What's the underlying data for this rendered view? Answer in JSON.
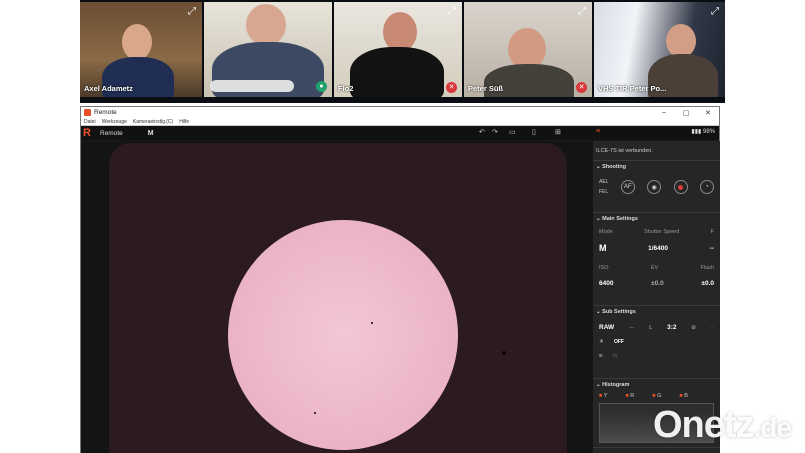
{
  "conference": {
    "participants": [
      {
        "name": "Axel Adametz",
        "muted": false
      },
      {
        "name": "",
        "muted": false
      },
      {
        "name": "Flo2",
        "muted": true
      },
      {
        "name": "Peter Süß",
        "muted": true
      },
      {
        "name": "VHS TIR Peter Po...",
        "muted": false
      }
    ]
  },
  "window": {
    "title": "Remote",
    "menu": [
      "Datei",
      "Werkzeuge",
      "Kameraeinstlg.(C)",
      "Hilfe"
    ],
    "toolbar": {
      "label": "Remote",
      "battery": "98%"
    }
  },
  "panel": {
    "status": "ILCE-7S ist verbunden.",
    "shooting": {
      "title": "Shooting",
      "af_label": "AEL",
      "fel_label": "FEL",
      "af_btn": "AF"
    },
    "main": {
      "title": "Main Settings",
      "mode_label": "Mode",
      "shutter_label": "Shutter Speed",
      "f_label": "F",
      "mode": "M",
      "shutter": "1/6400",
      "f": "--",
      "iso_label": "ISO",
      "ev_label": "EV",
      "flash_label": "Flash",
      "iso": "6400",
      "ev": "±0.0",
      "flash": "±0.0"
    },
    "sub": {
      "title": "Sub Settings",
      "raw": "RAW",
      "dash": "---",
      "l": "L",
      "ratio": "3:2",
      "off": "OFF"
    },
    "histogram": {
      "title": "Histogram",
      "channels": [
        "Y",
        "R",
        "G",
        "B"
      ]
    }
  },
  "watermark": {
    "main": "Onetz",
    "suffix": ".de"
  }
}
